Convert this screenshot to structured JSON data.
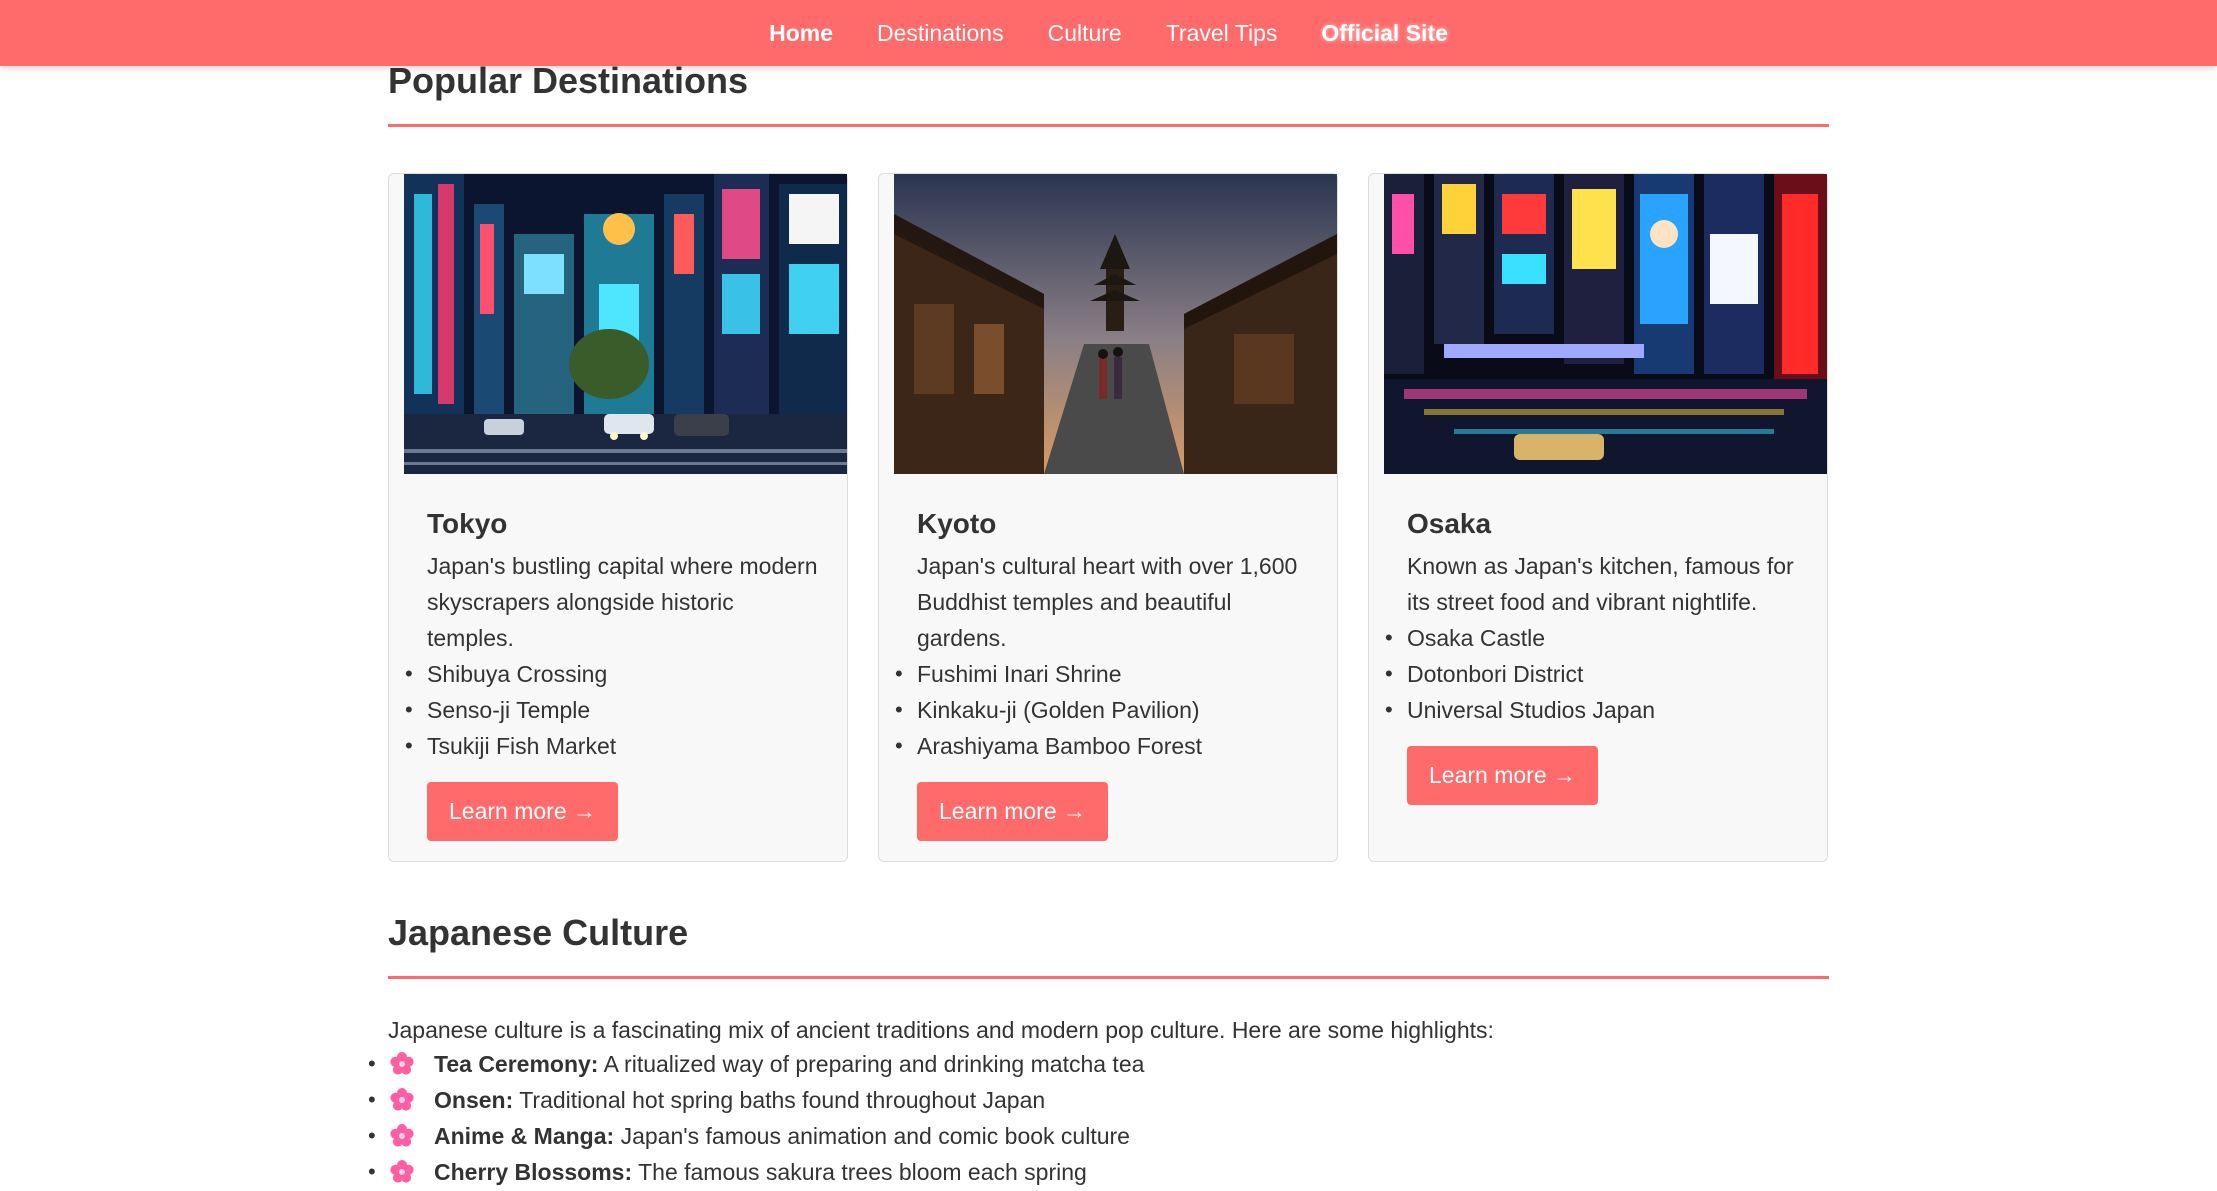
{
  "nav": {
    "items": [
      {
        "label": "Home"
      },
      {
        "label": "Destinations"
      },
      {
        "label": "Culture"
      },
      {
        "label": "Travel Tips"
      },
      {
        "label": "Official Site"
      }
    ]
  },
  "destinations": {
    "title": "Popular Destinations",
    "cards": [
      {
        "name": "Tokyo",
        "description": "Japan's bustling capital where modern skyscrapers alongside historic temples.",
        "highlights": [
          "Shibuya Crossing",
          "Senso-ji Temple",
          "Tsukiji Fish Market"
        ],
        "button": "Learn more →"
      },
      {
        "name": "Kyoto",
        "description": "Japan's cultural heart with over 1,600 Buddhist temples and beautiful gardens.",
        "highlights": [
          "Fushimi Inari Shrine",
          "Kinkaku-ji (Golden Pavilion)",
          "Arashiyama Bamboo Forest"
        ],
        "button": "Learn more →"
      },
      {
        "name": "Osaka",
        "description": "Known as Japan's kitchen, famous for its street food and vibrant nightlife.",
        "highlights": [
          "Osaka Castle",
          "Dotonbori District",
          "Universal Studios Japan"
        ],
        "button": "Learn more →"
      }
    ]
  },
  "culture": {
    "title": "Japanese Culture",
    "intro": "Japanese culture is a fascinating mix of ancient traditions and modern pop culture. Here are some highlights:",
    "items": [
      {
        "term": "Tea Ceremony:",
        "text": " A ritualized way of preparing and drinking matcha tea"
      },
      {
        "term": "Onsen:",
        "text": " Traditional hot spring baths found throughout Japan"
      },
      {
        "term": "Anime & Manga:",
        "text": " Japan's famous animation and comic book culture"
      },
      {
        "term": "Cherry Blossoms:",
        "text": " The famous sakura trees bloom each spring"
      }
    ]
  },
  "colors": {
    "accent": "#ff6b6b",
    "text": "#333333",
    "flower": "#ff5fa2"
  },
  "icons": {
    "culture_bullet": "cherry-blossom-icon"
  }
}
